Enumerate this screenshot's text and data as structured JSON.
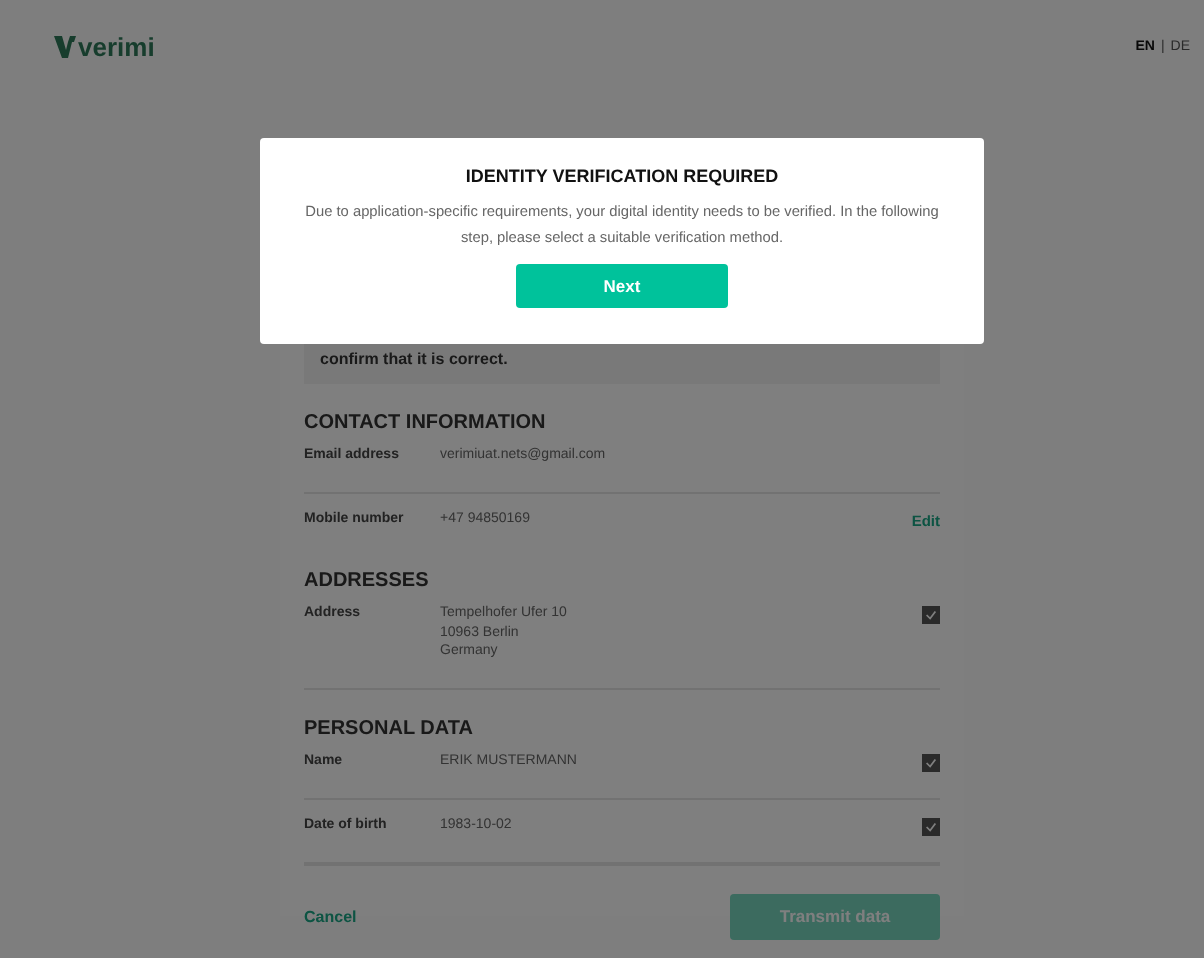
{
  "header": {
    "logo": "verimi",
    "languages": [
      {
        "label": "EN",
        "selected": true
      },
      {
        "label": "DE",
        "selected": false
      }
    ],
    "separator": "|"
  },
  "notice": {
    "text": "confirm that it is correct."
  },
  "sections": [
    {
      "heading": "CONTACT INFORMATION",
      "fields": [
        {
          "kind": "plain",
          "label": "Email address",
          "lines": [
            "verimiuat.nets@gmail.com"
          ]
        },
        {
          "kind": "edit",
          "label": "Mobile number",
          "lines": [
            "+47 94850169"
          ],
          "action": "Edit"
        }
      ]
    },
    {
      "heading": "ADDRESSES",
      "fields": [
        {
          "kind": "checkbox",
          "label": "Address",
          "lines": [
            "Tempelhofer Ufer 10",
            "10963 Berlin",
            "Germany"
          ],
          "checked": true
        }
      ]
    },
    {
      "heading": "PERSONAL DATA",
      "fields": [
        {
          "kind": "checkbox",
          "label": "Name",
          "lines": [
            "ERIK MUSTERMANN"
          ],
          "checked": true
        },
        {
          "kind": "checkbox",
          "label": "Date of birth",
          "lines": [
            "1983-10-02"
          ],
          "checked": true
        }
      ]
    }
  ],
  "footer": {
    "cancel": "Cancel",
    "submit": "Transmit data"
  },
  "modal": {
    "title": "IDENTITY VERIFICATION REQUIRED",
    "message": "Due to application-specific requirements, your digital identity needs to be verified. In the following step, please select a suitable verification method.",
    "button": "Next"
  }
}
